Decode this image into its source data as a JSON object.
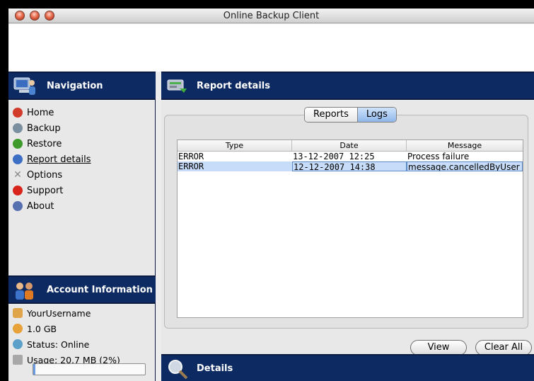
{
  "window": {
    "title": "Online Backup Client"
  },
  "navigation": {
    "header": "Navigation",
    "items": [
      {
        "label": "Home",
        "icon": "home-icon",
        "color": "#d23a2a"
      },
      {
        "label": "Backup",
        "icon": "backup-icon",
        "color": "#7a8fa0"
      },
      {
        "label": "Restore",
        "icon": "restore-icon",
        "color": "#3f9a2c"
      },
      {
        "label": "Report details",
        "icon": "report-icon",
        "color": "#3c6fc4"
      },
      {
        "label": "Options",
        "icon": "options-icon",
        "color": "#8a8a8a"
      },
      {
        "label": "Support",
        "icon": "support-icon",
        "color": "#d8241b"
      },
      {
        "label": "About",
        "icon": "about-icon",
        "color": "#5670b0"
      }
    ],
    "selected": "Report details"
  },
  "account": {
    "header": "Account Information",
    "username": "YourUsername",
    "quota": "1.0 GB",
    "status": "Status: Online",
    "usage": "Usage: 20.7 MB (2%)",
    "usage_fraction": 0.02
  },
  "report": {
    "header": "Report details",
    "tabs": [
      "Reports",
      "Logs"
    ],
    "active_tab": "Logs",
    "columns": [
      "Type",
      "Date",
      "Message"
    ],
    "rows": [
      [
        "ERROR",
        "13-12-2007 12:25",
        "Process failure"
      ],
      [
        "ERROR",
        "12-12-2007 14:38",
        "message.cancelledByUser"
      ]
    ],
    "selected_row": 1,
    "buttons": {
      "view": "View",
      "clear": "Clear All"
    }
  },
  "details": {
    "header": "Details"
  },
  "colors": {
    "header_bg": "#0d2a62",
    "selection": "#c7dcf8"
  }
}
